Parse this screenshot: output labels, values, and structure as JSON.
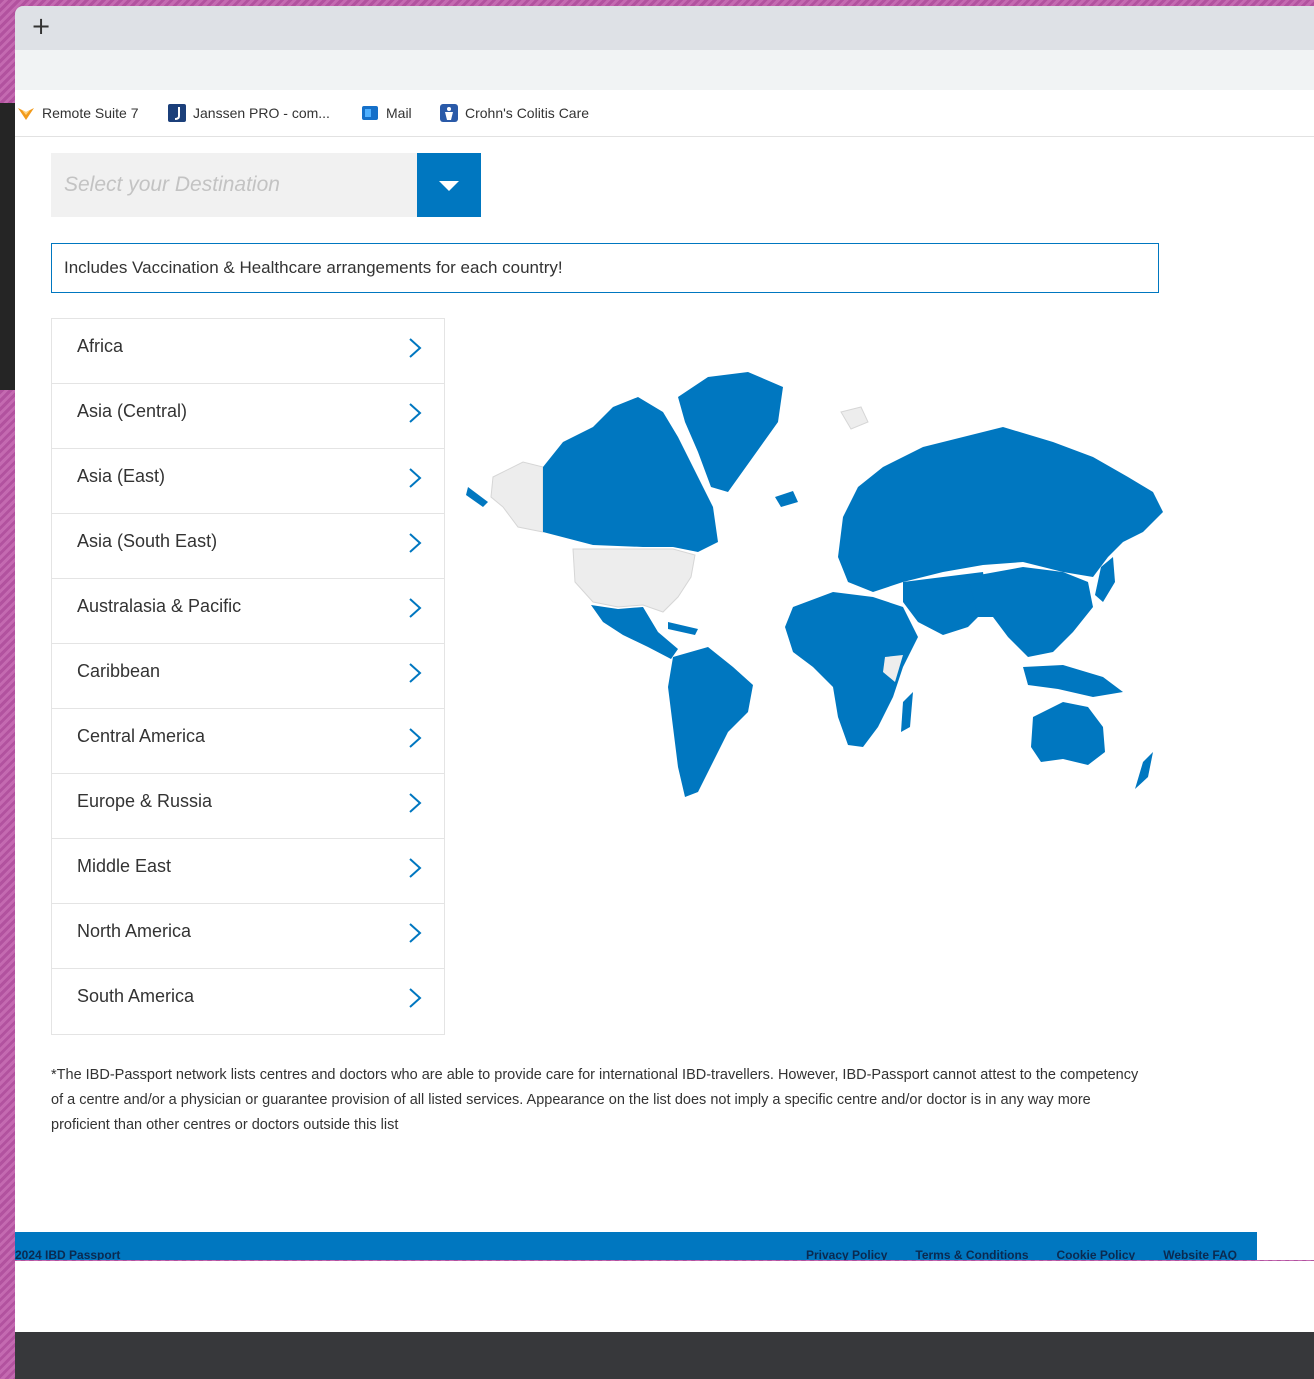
{
  "browser": {
    "new_tab_label": "+",
    "bookmarks": [
      {
        "label": "Remote Suite 7",
        "icon": "fox-icon"
      },
      {
        "label": "Janssen PRO - com...",
        "icon": "janssen-icon"
      },
      {
        "label": "Mail",
        "icon": "mail-icon"
      },
      {
        "label": "Crohn's Colitis Care",
        "icon": "ccc-icon"
      }
    ]
  },
  "destination_select": {
    "placeholder": "Select your Destination",
    "accent_color": "#0077c0"
  },
  "notice": "Includes Vaccination & Healthcare arrangements for each country!",
  "regions": [
    {
      "label": "Africa"
    },
    {
      "label": "Asia (Central)"
    },
    {
      "label": "Asia (East)"
    },
    {
      "label": "Asia (South East)"
    },
    {
      "label": "Australasia & Pacific"
    },
    {
      "label": "Caribbean"
    },
    {
      "label": "Central America"
    },
    {
      "label": "Europe & Russia"
    },
    {
      "label": "Middle East"
    },
    {
      "label": "North America"
    },
    {
      "label": "South America"
    }
  ],
  "map": {
    "covered_color": "#0077c0",
    "not_covered_color": "#ededed"
  },
  "disclaimer": "*The IBD-Passport network lists centres and doctors who are able to provide care for international IBD-travellers. However, IBD-Passport cannot attest to the competency of a centre and/or a physician or guarantee provision of all listed services. Appearance on the list does not imply a specific centre and/or doctor is in any way more proficient than other centres or doctors outside this list",
  "footer": {
    "copyright": "2024 IBD Passport",
    "links": [
      "Privacy Policy",
      "Terms & Conditions",
      "Cookie Policy",
      "Website FAQ"
    ]
  }
}
